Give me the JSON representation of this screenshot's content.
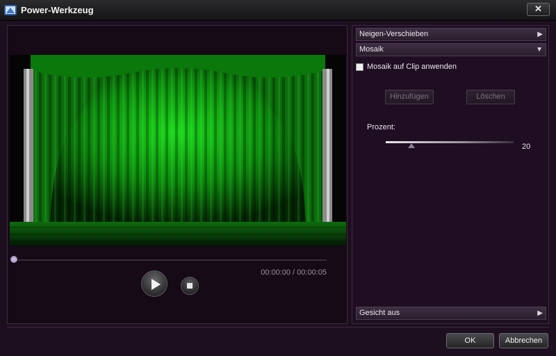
{
  "window": {
    "title": "Power-Werkzeug",
    "icon": "app-icon",
    "close_label": "✕"
  },
  "player": {
    "scene": "green stage curtain",
    "progress": 0.0,
    "time_display": "00:00:00 / 00:00:05",
    "play_icon": "play-icon",
    "stop_icon": "stop-icon"
  },
  "panel": {
    "sections": {
      "tilt_shift": {
        "label": "Neigen-Verschieben",
        "arrow": "▶"
      },
      "mosaic": {
        "label": "Mosaik",
        "arrow": "▼"
      },
      "face_off": {
        "label": "Gesicht aus",
        "arrow": "▶"
      }
    },
    "mosaic_checkbox": {
      "label": "Mosaik auf Clip anwenden",
      "checked": false
    },
    "add_label": "Hinzufügen",
    "delete_label": "Löschen",
    "percent": {
      "label": "Prozent:",
      "value": "20",
      "level": 0.2
    }
  },
  "footer": {
    "ok_label": "OK",
    "cancel_label": "Abbrechen"
  }
}
